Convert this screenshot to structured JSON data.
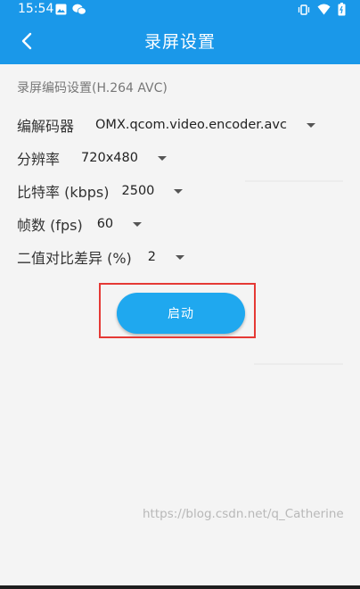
{
  "status_bar": {
    "time": "15:54",
    "left_icons": [
      "image-icon",
      "wechat-icon"
    ],
    "right_icons": [
      "vibrate-icon",
      "wifi-icon",
      "battery-icon"
    ]
  },
  "title_bar": {
    "title": "录屏设置",
    "back_icon": "chevron-left-icon"
  },
  "section": {
    "label": "录屏编码设置(H.264 AVC)"
  },
  "form": {
    "encoder": {
      "label": "编解码器",
      "value": "OMX.qcom.video.encoder.avc"
    },
    "resolution": {
      "label": "分辨率",
      "value": "720x480"
    },
    "bitrate": {
      "label": "比特率 (kbps)",
      "value": "2500"
    },
    "fps": {
      "label": "帧数 (fps)",
      "value": "60"
    },
    "diff": {
      "label": "二值对比差异 (%)",
      "value": "2"
    }
  },
  "start_button": {
    "label": "启动"
  },
  "watermark": "https://blog.csdn.net/q_Catherine",
  "colors": {
    "primary": "#1a98e9",
    "button": "#1fa8ef",
    "highlight_border": "#e53935",
    "background": "#f4f4f4"
  }
}
